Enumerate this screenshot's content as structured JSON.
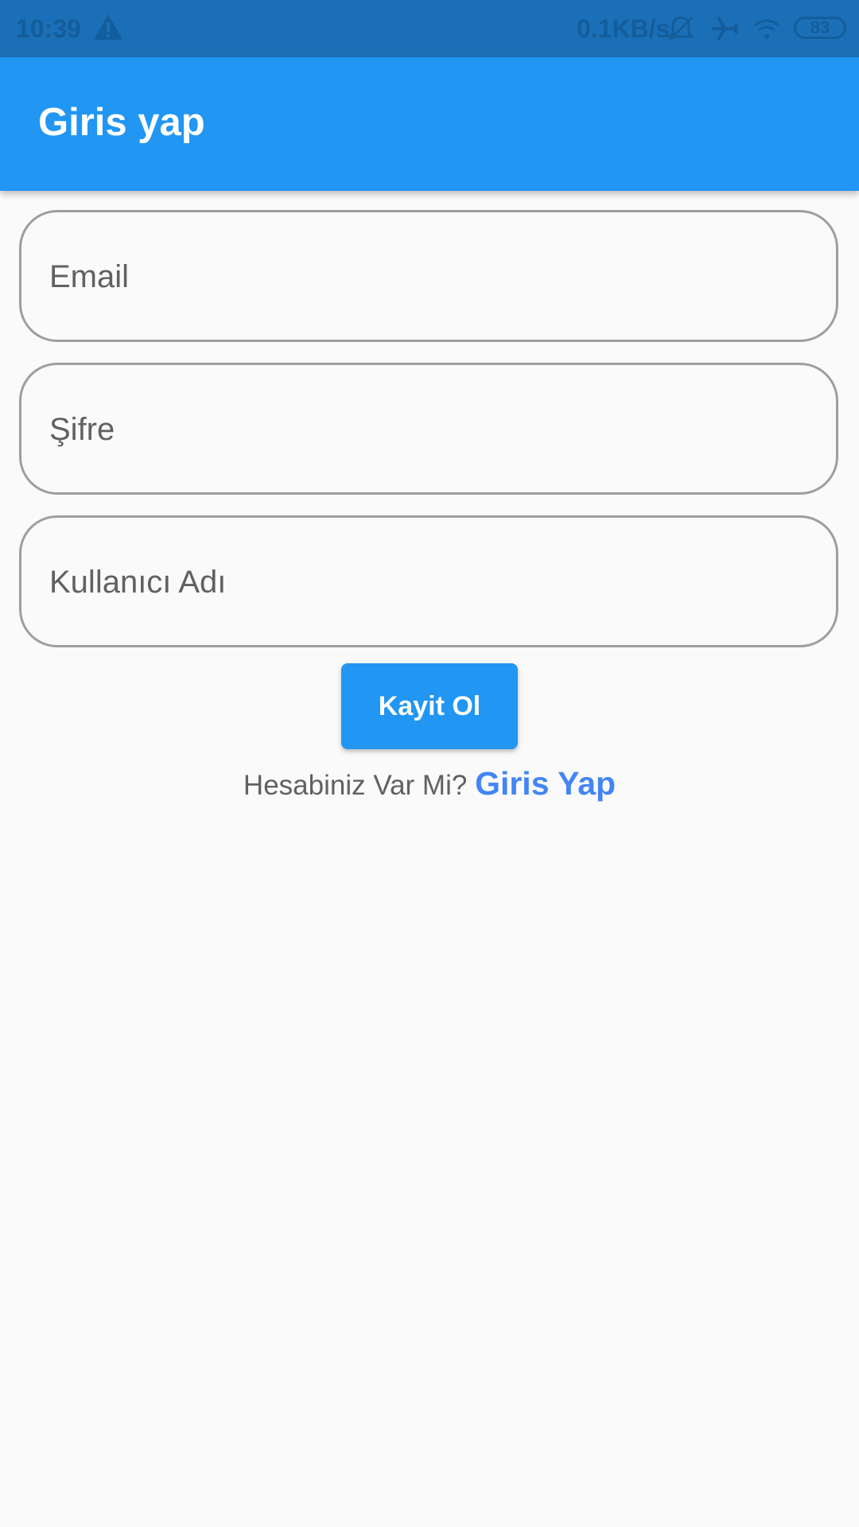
{
  "status_bar": {
    "time": "10:39",
    "net_speed": "0.1KB/s",
    "battery": "83",
    "icons": [
      "warning-icon",
      "bell-off-icon",
      "airplane-icon",
      "wifi-icon",
      "battery-icon"
    ]
  },
  "app_bar": {
    "title": "Giris yap",
    "color": "#2196f3"
  },
  "form": {
    "email_placeholder": "Email",
    "password_placeholder": "Şifre",
    "username_placeholder": "Kullanıcı Adı",
    "submit_label": "Kayit Ol"
  },
  "footer": {
    "prompt": "Hesabiniz Var Mi?",
    "link_label": "Giris Yap"
  }
}
